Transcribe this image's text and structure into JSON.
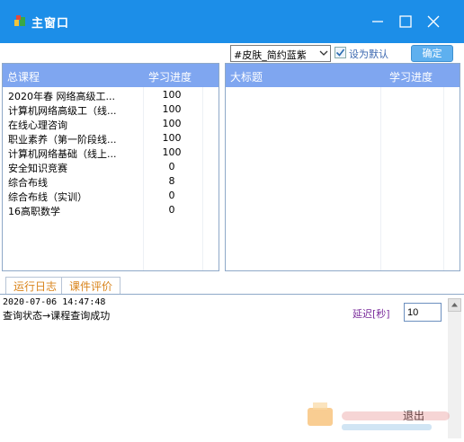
{
  "window": {
    "title": "主窗口"
  },
  "toolbar": {
    "skin_value": "#皮肤_简约蓝紫",
    "default_checkbox_label": "设为默认",
    "default_checked": true,
    "ok_label": "确定"
  },
  "course_panel": {
    "col_course": "总课程",
    "col_progress": "学习进度",
    "rows": [
      {
        "name": "2020年春 网络高级工...",
        "progress": "100"
      },
      {
        "name": "计算机网络高级工（线...",
        "progress": "100"
      },
      {
        "name": "在线心理咨询",
        "progress": "100"
      },
      {
        "name": "职业素养（第一阶段线...",
        "progress": "100"
      },
      {
        "name": "计算机网络基础（线上...",
        "progress": "100"
      },
      {
        "name": "安全知识竞赛",
        "progress": "0"
      },
      {
        "name": "综合布线",
        "progress": "8"
      },
      {
        "name": "综合布线（实训）",
        "progress": "0"
      },
      {
        "name": "16高职数学",
        "progress": "0"
      }
    ]
  },
  "chapter_panel": {
    "col_title": "大标题",
    "col_progress": "学习进度"
  },
  "tabs": {
    "log": "运行日志",
    "evaluation": "课件评价"
  },
  "log": {
    "timestamp": "2020-07-06 14:47:48",
    "message": "查询状态→课程查询成功",
    "delay_label": "延迟[秒]",
    "delay_value": "10",
    "exit_label": "退出"
  },
  "colors": {
    "titlebar": "#1c8ee8",
    "header": "#7fa6f0",
    "accent_button": "#5eb0ef"
  }
}
